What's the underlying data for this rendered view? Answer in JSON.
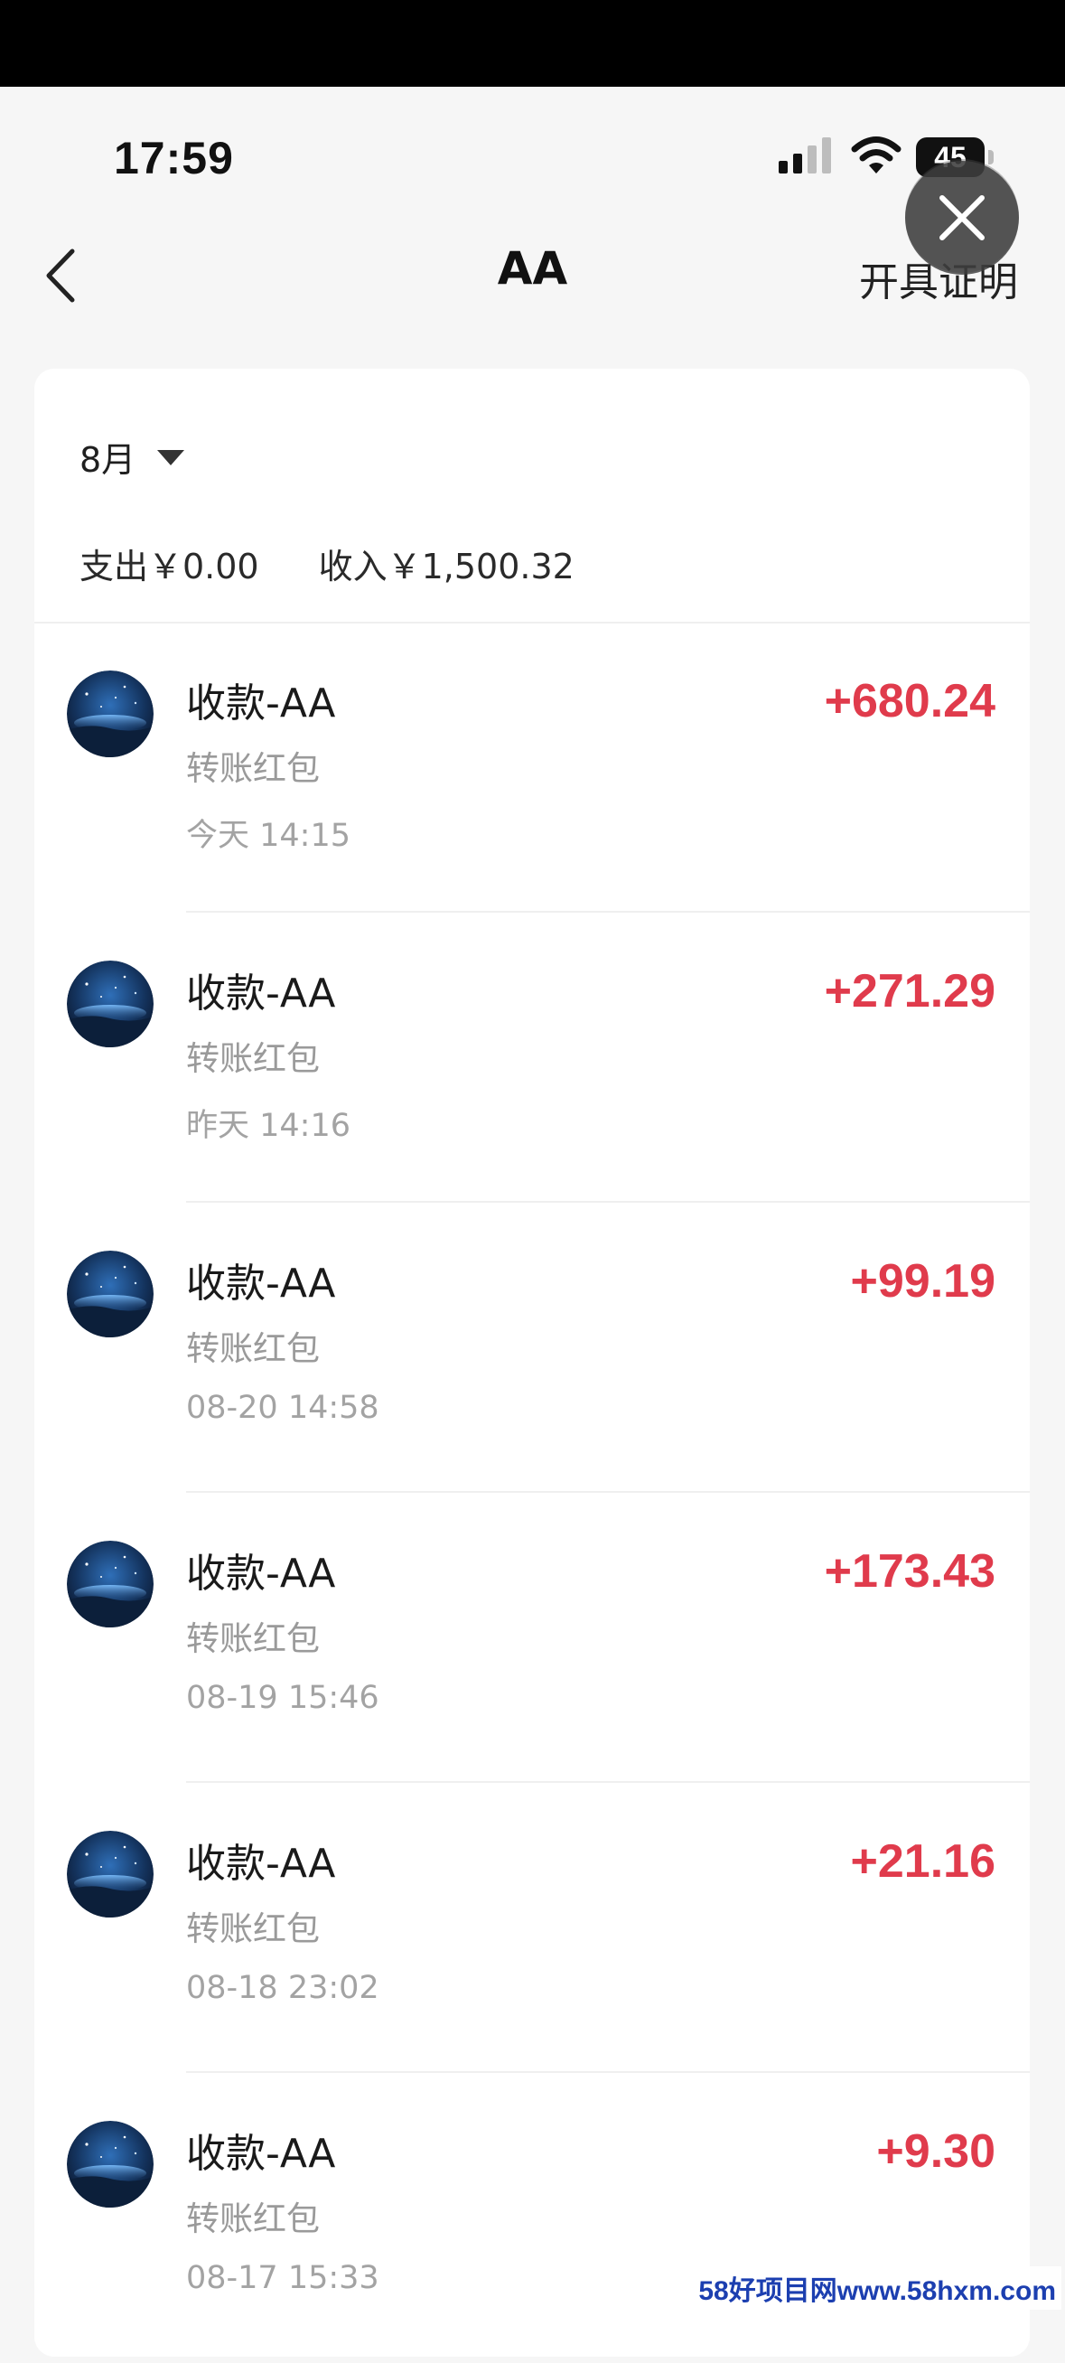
{
  "status_bar": {
    "time": "17:59",
    "battery": "45"
  },
  "nav": {
    "title": "AA",
    "action_label": "开具证明"
  },
  "filter": {
    "month_label": "8月"
  },
  "summary": {
    "expense": "支出￥0.00",
    "income": "收入￥1,500.32"
  },
  "transactions": [
    {
      "title": "收款-AA",
      "subtitle": "转账红包",
      "time": "今天 14:15",
      "amount": "+680.24"
    },
    {
      "title": "收款-AA",
      "subtitle": "转账红包",
      "time": "昨天 14:16",
      "amount": "+271.29"
    },
    {
      "title": "收款-AA",
      "subtitle": "转账红包",
      "time": "08-20 14:58",
      "amount": "+99.19"
    },
    {
      "title": "收款-AA",
      "subtitle": "转账红包",
      "time": "08-19 15:46",
      "amount": "+173.43"
    },
    {
      "title": "收款-AA",
      "subtitle": "转账红包",
      "time": "08-18 23:02",
      "amount": "+21.16"
    },
    {
      "title": "收款-AA",
      "subtitle": "转账红包",
      "time": "08-17 15:33",
      "amount": "+9.30"
    }
  ],
  "colors": {
    "income_amount": "#e03b4c",
    "background": "#f6f6f6",
    "card": "#ffffff"
  },
  "icons": {
    "back": "chevron-left-icon",
    "dropdown": "caret-down-icon",
    "close": "close-icon",
    "signal": "cellular-signal-icon",
    "wifi": "wifi-icon",
    "battery": "battery-icon"
  },
  "watermark": "58好项目网www.58hxm.com"
}
